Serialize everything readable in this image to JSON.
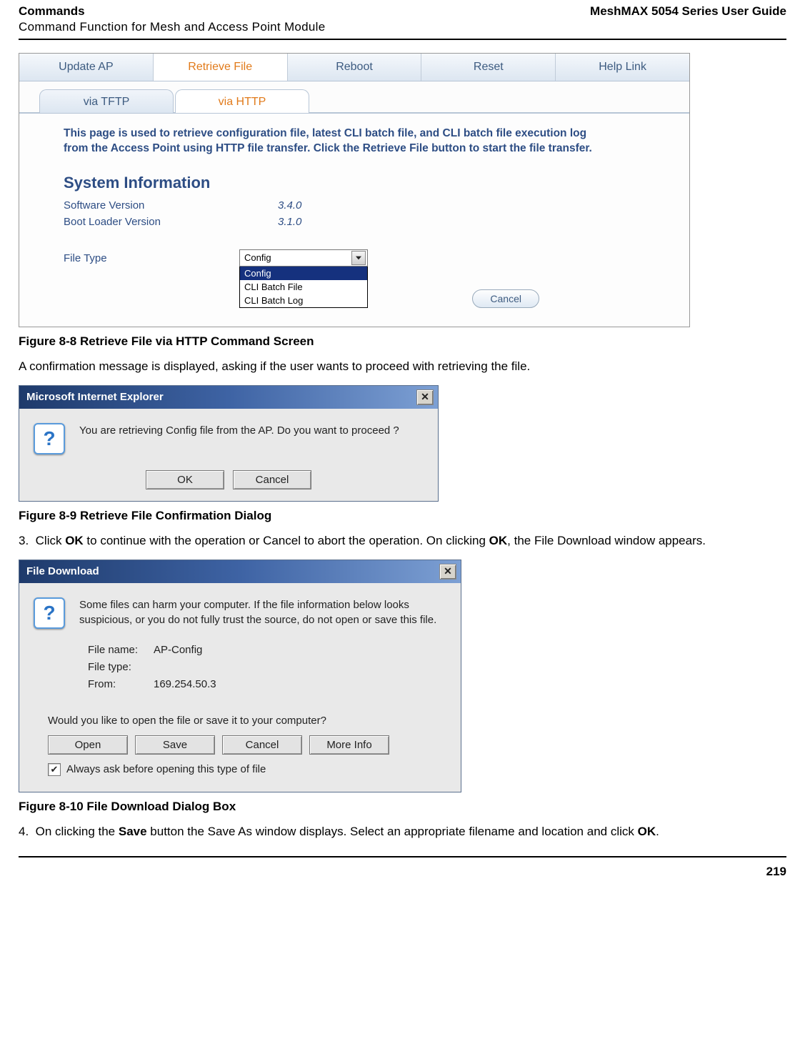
{
  "header": {
    "left_title": "Commands",
    "right_title": "MeshMAX 5054 Series User Guide",
    "subtitle": "Command Function for Mesh and Access Point Module"
  },
  "fig8_8": {
    "tabs": [
      "Update AP",
      "Retrieve File",
      "Reboot",
      "Reset",
      "Help Link"
    ],
    "active_tab_index": 1,
    "subtabs": [
      "via TFTP",
      "via HTTP"
    ],
    "active_subtab_index": 1,
    "description": "This page is used to retrieve configuration file, latest CLI batch file, and CLI batch file execution log from the Access Point using HTTP file transfer. Click the Retrieve File button to start the file transfer.",
    "section_title": "System Information",
    "rows": [
      {
        "label": "Software Version",
        "value": "3.4.0"
      },
      {
        "label": "Boot Loader Version",
        "value": "3.1.0"
      }
    ],
    "file_type_label": "File Type",
    "combo_selected": "Config",
    "combo_options": [
      "Config",
      "CLI Batch File",
      "CLI Batch Log"
    ],
    "cancel": "Cancel",
    "caption": "Figure 8-8 Retrieve File via HTTP Command Screen"
  },
  "text1": "A confirmation message is displayed, asking if the user wants to proceed with retrieving the file.",
  "fig8_9": {
    "title": "Microsoft Internet Explorer",
    "message": "You are retrieving Config file from the AP. Do you want to proceed ?",
    "ok": "OK",
    "cancel": "Cancel",
    "caption": "Figure 8-9 Retrieve File Confirmation Dialog"
  },
  "step3": {
    "num": "3.",
    "pre": "Click ",
    "b1": "OK",
    "mid": " to continue with the operation or Cancel to abort the operation. On clicking ",
    "b2": "OK",
    "post": ", the File Download window appears."
  },
  "fig8_10": {
    "title": "File Download",
    "warn": "Some files can harm your computer. If the file information below looks suspicious, or you do not fully trust the source, do not open or save this file.",
    "file_name_label": "File name:",
    "file_name": "AP-Config",
    "file_type_label": "File type:",
    "file_type": "",
    "from_label": "From:",
    "from": "169.254.50.3",
    "question": "Would you like to open the file or save it to your computer?",
    "buttons": [
      "Open",
      "Save",
      "Cancel",
      "More Info"
    ],
    "checkbox_checked": true,
    "checkbox_label": "Always ask before opening this type of file",
    "caption": "Figure 8-10 File Download Dialog Box"
  },
  "step4": {
    "num": "4.",
    "pre": "On clicking the ",
    "b1": "Save",
    "mid": " button the Save As window displays. Select an appropriate filename and location and click ",
    "b2": "OK",
    "post": "."
  },
  "page_number": "219"
}
